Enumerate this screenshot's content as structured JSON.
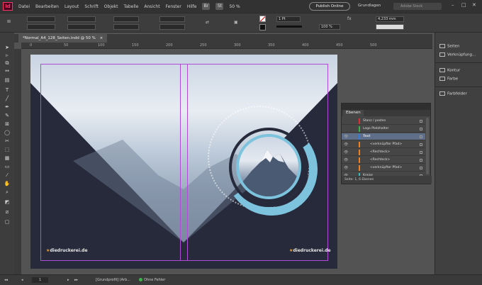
{
  "menubar": {
    "logo": "Id",
    "items": [
      "Datei",
      "Bearbeiten",
      "Layout",
      "Schrift",
      "Objekt",
      "Tabelle",
      "Ansicht",
      "Fenster",
      "Hilfe"
    ],
    "bridge_icon": "Br",
    "stock_icon": "St",
    "zoom": "50 %",
    "publish_label": "Publish Online",
    "workspace": "Grundlagen",
    "search_placeholder": "Adobe Stock",
    "window_controls": [
      "–",
      "□",
      "✕"
    ]
  },
  "control": {
    "x_value": "0 Pt",
    "stroke_weight": "1 Pt",
    "percent": "100 %",
    "size_value": "4,233 mm"
  },
  "document": {
    "tab_title": "*Normal_A4_128_Seiten.indd @ 50 %",
    "close": "×"
  },
  "ruler": {
    "marks": [
      "0",
      "50",
      "100",
      "150",
      "200",
      "250",
      "300",
      "350",
      "400",
      "450",
      "500"
    ]
  },
  "spread": {
    "brand_left_prefix": "★",
    "brand_left": "diedruckerei.de",
    "brand_right_prefix": "★",
    "brand_right": "diedruckerei.de"
  },
  "layers_panel": {
    "tab": "Ebenen",
    "rows": [
      {
        "name": "Stanz / posten",
        "color": "#e03030",
        "eye": "",
        "selected": false
      },
      {
        "name": "Logo Platzhalter",
        "color": "#3cb44b",
        "eye": "",
        "selected": false
      },
      {
        "name": "Text",
        "color": "#3a7bd5",
        "eye": "👁",
        "selected": true
      },
      {
        "name": "<verknüpfter Pfad>",
        "color": "#f08020",
        "eye": "👁",
        "selected": false
      },
      {
        "name": "<Rechteck>",
        "color": "#f08020",
        "eye": "👁",
        "selected": false
      },
      {
        "name": "<Rechteck>",
        "color": "#f08020",
        "eye": "👁",
        "selected": false
      },
      {
        "name": "<verknüpfter Pfad>",
        "color": "#f08020",
        "eye": "👁",
        "selected": false
      },
      {
        "name": "Kreise",
        "color": "#30c0c0",
        "eye": "👁",
        "selected": false
      }
    ],
    "footer": "Seite: 1, 6 Ebenen"
  },
  "right_panel": {
    "items": [
      "Seiten",
      "Verknüpfung...",
      "Kontur",
      "Farbe",
      "Farbfelder"
    ]
  },
  "status": {
    "page": "1",
    "profile": "[Grundprofil] (Arb...",
    "preflight": "Ohne Fehler"
  },
  "colors": {
    "accent": "#ff3366",
    "navy": "#262a3a",
    "ring": "#7dc3dd",
    "guide": "#b04cd8"
  }
}
